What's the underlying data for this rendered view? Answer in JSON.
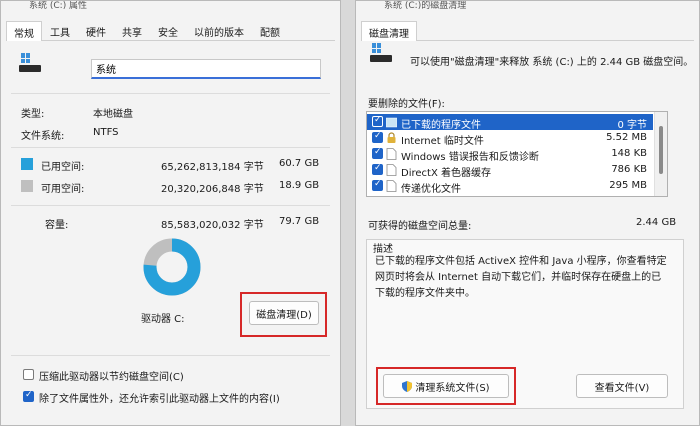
{
  "left": {
    "title": "系统 (C:) 属性",
    "tabs": [
      "常规",
      "工具",
      "硬件",
      "共享",
      "安全",
      "以前的版本",
      "配额"
    ],
    "drive_name": "系统",
    "type_label": "类型:",
    "type_value": "本地磁盘",
    "fs_label": "文件系统:",
    "fs_value": "NTFS",
    "used_label": "已用空间:",
    "used_bytes": "65,262,813,184 字节",
    "used_gb": "60.7 GB",
    "free_label": "可用空间:",
    "free_bytes": "20,320,206,848 字节",
    "free_gb": "18.9 GB",
    "capacity_label": "容量:",
    "capacity_bytes": "85,583,020,032 字节",
    "capacity_gb": "79.7 GB",
    "used_fraction": 0.762,
    "drive_label": "驱动器 C:",
    "cleanup_button": "磁盘清理(D)",
    "compress_label": "压缩此驱动器以节约磁盘空间(C)",
    "index_label": "除了文件属性外，还允许索引此驱动器上文件的内容(I)",
    "colors": {
      "used": "#26a0da",
      "free": "#bfbfbf"
    }
  },
  "right": {
    "title": "系统 (C:)的磁盘清理",
    "tab": "磁盘清理",
    "intro": "可以使用\"磁盘清理\"来释放 系统 (C:) 上的 2.44 GB 磁盘空间。",
    "files_label": "要删除的文件(F):",
    "files": [
      {
        "name": "已下载的程序文件",
        "size": "0 字节",
        "checked": true,
        "selected": true,
        "icon": "folder-icon"
      },
      {
        "name": "Internet 临时文件",
        "size": "5.52 MB",
        "checked": true,
        "selected": false,
        "icon": "lock-icon"
      },
      {
        "name": "Windows 错误报告和反馈诊断",
        "size": "148 KB",
        "checked": true,
        "selected": false,
        "icon": "file-icon"
      },
      {
        "name": "DirectX 着色器缓存",
        "size": "786 KB",
        "checked": true,
        "selected": false,
        "icon": "file-icon"
      },
      {
        "name": "传递优化文件",
        "size": "295 MB",
        "checked": true,
        "selected": false,
        "icon": "file-icon"
      }
    ],
    "total_label": "可获得的磁盘空间总量:",
    "total_value": "2.44 GB",
    "desc_title": "描述",
    "desc_text": "已下载的程序文件包括 ActiveX 控件和 Java 小程序，你查看特定网页时将会从 Internet 自动下载它们，并临时保存在硬盘上的已下载的程序文件夹中。",
    "clean_system_button": "清理系统文件(S)",
    "view_files_button": "查看文件(V)"
  }
}
